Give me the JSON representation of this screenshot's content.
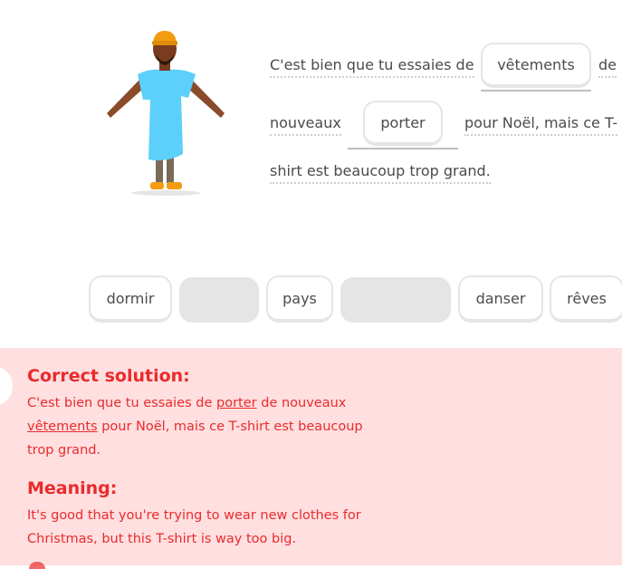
{
  "sentence": {
    "t1": "C'est bien que tu essaies de",
    "slot1": "vêtements",
    "t2": "de",
    "t3": "nouveaux",
    "slot2": "porter",
    "t4": "pour Noël, mais ce T-",
    "t5": "shirt est beaucoup trop grand."
  },
  "word_bank": [
    "dormir",
    "pays",
    "danser",
    "rêves"
  ],
  "feedback": {
    "correct_title": "Correct solution:",
    "sol_a": "C'est bien que tu essaies de ",
    "sol_u1": "porter",
    "sol_b": " de nouveaux",
    "sol_u2": "vêtements",
    "sol_c": " pour Noël, mais ce T-shirt est beaucoup trop grand.",
    "meaning_title": "Meaning:",
    "meaning_text": "It's good that you're trying to wear new clothes for Christmas, but this T-shirt is way too big."
  },
  "colors": {
    "feedback_bg": "#ffdfe0",
    "feedback_text": "#ea2b2b",
    "shirt": "#5ccffa",
    "hat": "#f39c12"
  }
}
